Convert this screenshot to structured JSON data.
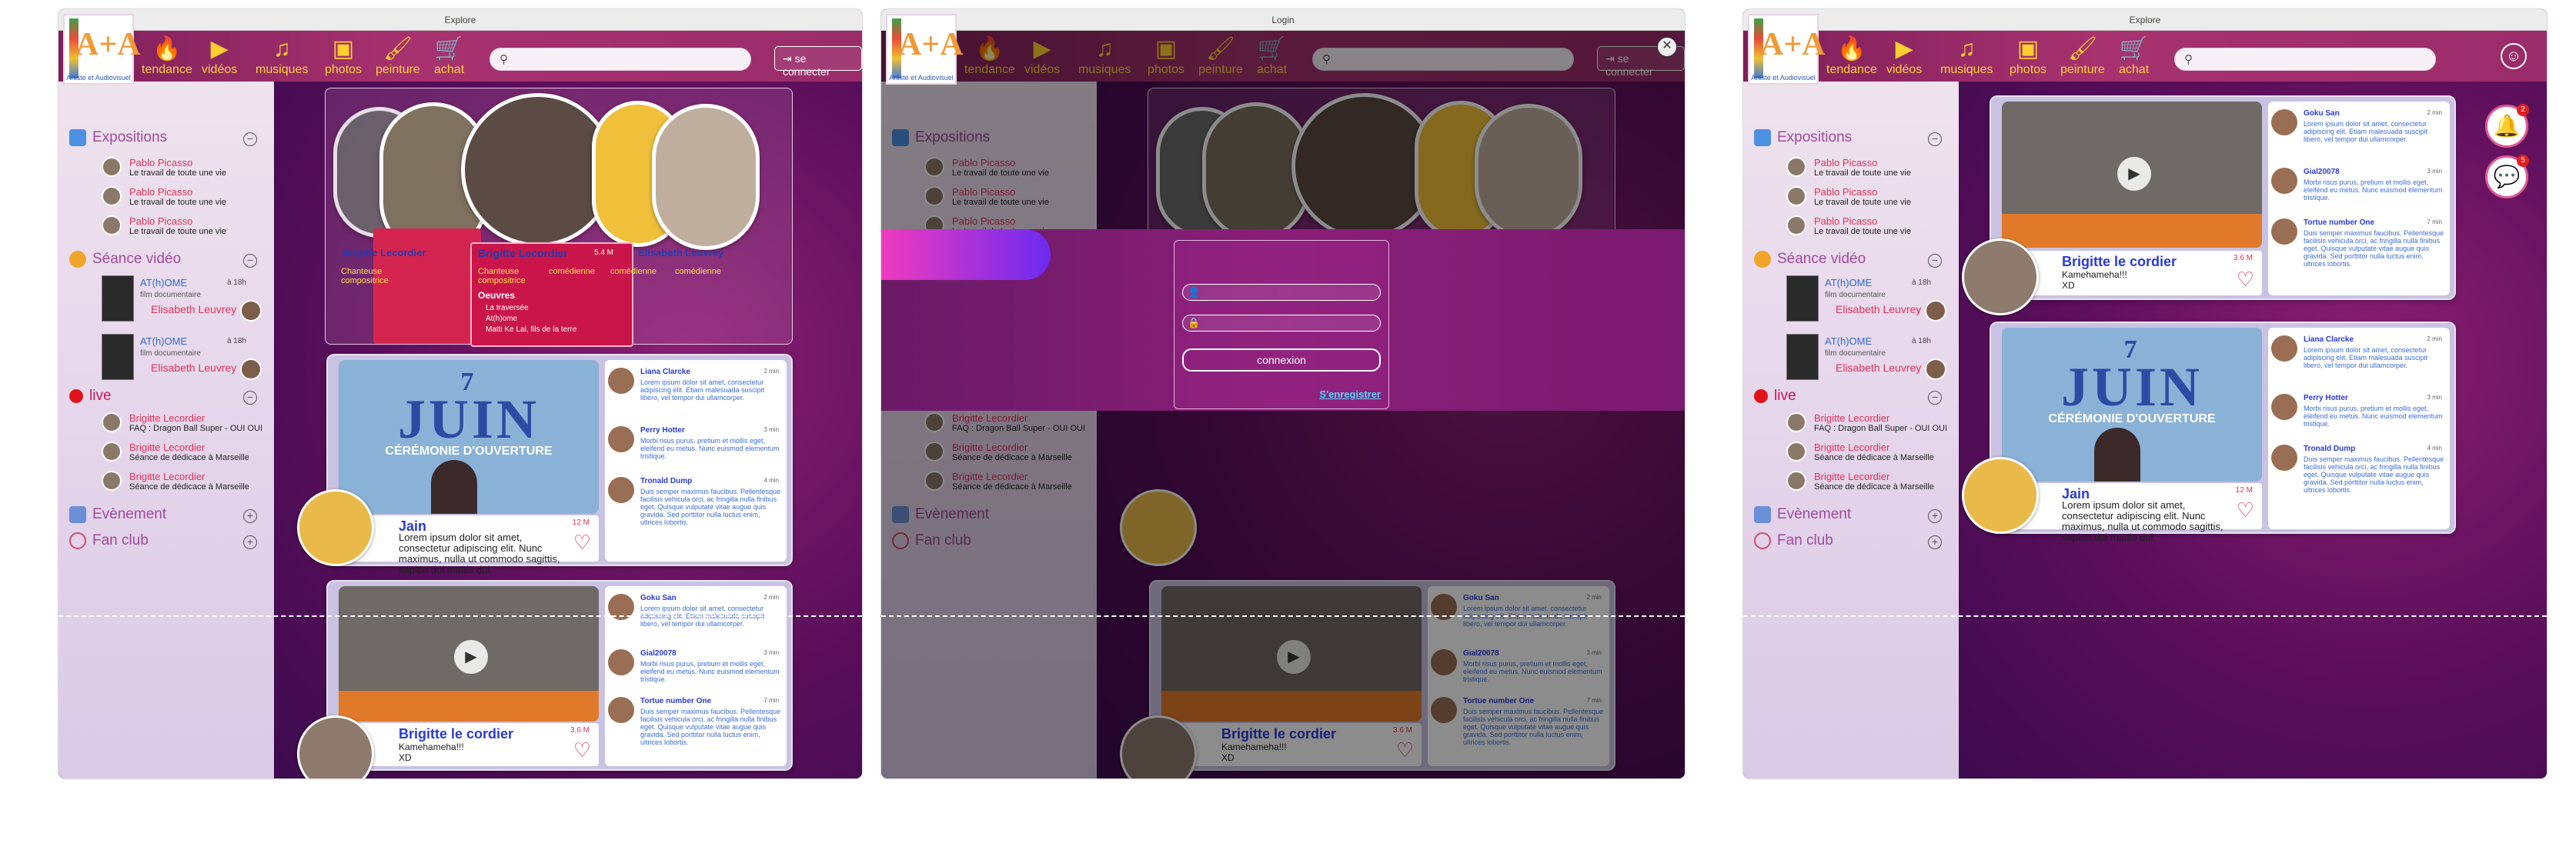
{
  "windows": [
    {
      "title": "Explore"
    },
    {
      "title": "Login"
    },
    {
      "title": "Explore"
    }
  ],
  "logo": {
    "caption": "Artiste et Audiovisuel"
  },
  "nav": [
    {
      "label": "tendance",
      "icon": "flame-icon",
      "glyph": "🔥"
    },
    {
      "label": "vidéos",
      "icon": "video-icon",
      "glyph": "▶"
    },
    {
      "label": "musiques",
      "icon": "music-icon",
      "glyph": "♫"
    },
    {
      "label": "photos",
      "icon": "photo-icon",
      "glyph": "▣"
    },
    {
      "label": "peinture",
      "icon": "brush-icon",
      "glyph": "🖌"
    },
    {
      "label": "achat",
      "icon": "cart-icon",
      "glyph": "🛒"
    }
  ],
  "connect_label": "se connecter",
  "sidebar": {
    "expositions": {
      "title": "Expositions",
      "items": [
        {
          "name": "Pablo Picasso",
          "sub": "Le travail de toute une vie"
        },
        {
          "name": "Pablo Picasso",
          "sub": "Le travail de toute une vie"
        },
        {
          "name": "Pablo Picasso",
          "sub": "Le travail de toute une vie"
        }
      ]
    },
    "seance": {
      "title": "Séance vidéo",
      "items": [
        {
          "title": "AT(h)OME",
          "sub": "film documentaire",
          "time": "à 18h",
          "user": "Elisabeth Leuvrey"
        },
        {
          "title": "AT(h)OME",
          "sub": "film documentaire",
          "time": "à 18h",
          "user": "Elisabeth Leuvrey"
        }
      ]
    },
    "live": {
      "title": "live",
      "items": [
        {
          "name": "Brigitte Lecordier",
          "sub": "FAQ : Dragon Ball Super - OUI OUI"
        },
        {
          "name": "Brigitte Lecordier",
          "sub": "Séance de dédicace à Marseille"
        },
        {
          "name": "Brigitte Lecordier",
          "sub": "Séance de dédicace à Marseille"
        }
      ]
    },
    "evenement": "Evènement",
    "fanclub": "Fan club"
  },
  "artists": {
    "featured_name": "Brigitte Lecordier",
    "other_name": "Elisabeth Leuvrey",
    "role1": "Chanteuse compositrice",
    "role2": "comédienne",
    "count": "5.4 M",
    "oeuvres_title": "Oeuvres",
    "oeuvres": [
      "La traversée",
      "At(h)ome",
      "Matti Ke Lal, fils de la terre"
    ],
    "side_left_name": "Brigitte Lecordier",
    "side_role": "Chanteuse compositrice",
    "side_role2": "comédienne"
  },
  "post_jain": {
    "event_line1": "7",
    "event_line2": "JUIN",
    "event_line3": "CÉRÉMONIE D'OUVERTURE",
    "title": "Jain",
    "likes": "12 M",
    "text": "Lorem ipsum dolor sit amet, consectetur adipiscing elit. Nunc maximus, nulla ut commodo sagittis, sapien dui mattis dui."
  },
  "post_bl": {
    "title": "Brigitte le cordier",
    "sub1": "Kamehameha!!!",
    "sub2": "XD",
    "likes": "3.6 M"
  },
  "comments_jain": [
    {
      "name": "Liana Clarcke",
      "time": "2 min",
      "text": "Lorem ipsum dolor sit amet, consectetur adipiscing elit. Etiam malesuada suscipit libero, vel tempor dui ullamcorper."
    },
    {
      "name": "Perry Hotter",
      "time": "3 min",
      "text": "Morbi risus purus, pretium et mollis eget, eleifend eu metus. Nunc euismod elementum tristique."
    },
    {
      "name": "Tronald Dump",
      "time": "4 min",
      "text": "Duis semper maximus faucibus. Pellentesque facilisis vehicula orci, ac fringilla nulla finibus eget. Quisque vulputate vitae augue quis gravida. Sed porttitor nulla luctus enim, ultrices lobortis."
    }
  ],
  "comments_bl": [
    {
      "name": "Goku San",
      "time": "2 min",
      "text": "Lorem ipsum dolor sit amet, consectetur adipiscing elit. Etiam malesuada suscipit libero, vel tempor dui ullamcorper."
    },
    {
      "name": "Gial20078",
      "time": "3 min",
      "text": "Morbi risus purus, pretium et mollis eget, eleifend eu metus. Nunc euismod elementum tristique."
    },
    {
      "name": "Tortue number One",
      "time": "7 min",
      "text": "Duis semper maximus faucibus. Pellentesque facilisis vehicula orci, ac fringilla nulla finibus eget. Quisque vulputate vitae augue quis gravida. Sed porttitor nulla luctus enim, ultrices lobortis."
    }
  ],
  "login": {
    "button": "connexion",
    "register": "S'enregistrer"
  },
  "badges": {
    "notif": "2",
    "chat": "5"
  }
}
